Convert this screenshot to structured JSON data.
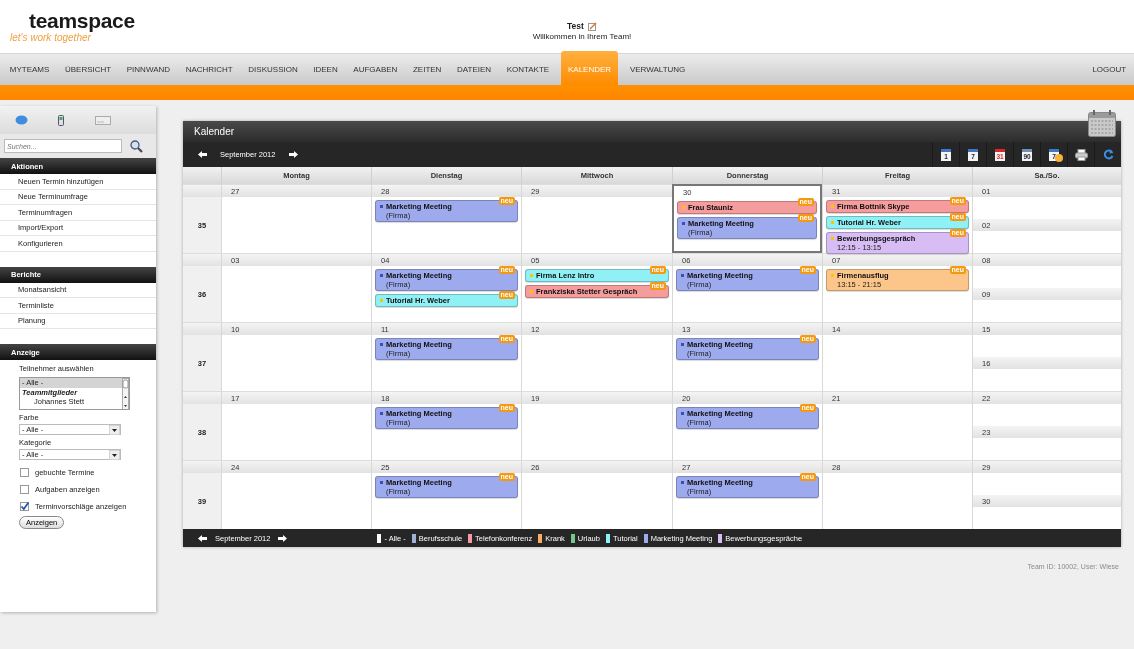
{
  "header": {
    "logo": "teamspace",
    "tagline": "let's work together",
    "user": "Test",
    "welcome": "Willkommen in Ihrem Team!"
  },
  "nav": {
    "tabs": [
      {
        "label": "MYTEAMS",
        "selected": false
      },
      {
        "label": "ÜBERSICHT",
        "selected": false
      },
      {
        "label": "PINNWAND",
        "selected": false
      },
      {
        "label": "NACHRICHT",
        "selected": false
      },
      {
        "label": "DISKUSSION",
        "selected": false
      },
      {
        "label": "IDEEN",
        "selected": false
      },
      {
        "label": "AUFGABEN",
        "selected": false
      },
      {
        "label": "ZEITEN",
        "selected": false
      },
      {
        "label": "DATEIEN",
        "selected": false
      },
      {
        "label": "KONTAKTE",
        "selected": false
      },
      {
        "label": "KALENDER",
        "selected": true
      },
      {
        "label": "VERWALTUNG",
        "selected": false
      }
    ],
    "logout": "LOGOUT"
  },
  "sidebar": {
    "search": {
      "placeholder": "Suchen..."
    },
    "sections": [
      {
        "title": "Aktionen",
        "items": [
          "Neuen Termin hinzufügen",
          "Neue Terminumfrage",
          "Terminumfragen",
          "Import/Export",
          "Konfigurieren"
        ]
      },
      {
        "title": "Berichte",
        "items": [
          "Monatsansicht",
          "Terminliste",
          "Planung"
        ]
      }
    ],
    "display": {
      "title": "Anzeige",
      "participants_label": "Teilnehmer auswählen",
      "participants": [
        {
          "label": "- Alle -",
          "kind": "option",
          "selected": true
        },
        {
          "label": "Teammitglieder",
          "kind": "group",
          "selected": false
        },
        {
          "label": "Johannes Stett",
          "kind": "member",
          "selected": false
        }
      ],
      "color_label": "Farbe",
      "color_value": "- Alle -",
      "category_label": "Kategorie",
      "category_value": "- Alle -",
      "checkboxes": [
        {
          "label": "gebuchte Termine",
          "checked": false
        },
        {
          "label": "Aufgaben anzeigen",
          "checked": false
        },
        {
          "label": "Terminvorschläge anzeigen",
          "checked": true
        }
      ],
      "button": "Anzeigen"
    }
  },
  "calendar": {
    "title": "Kalender",
    "month": "September 2012",
    "toolbar": [
      {
        "kind": "page",
        "label": "1",
        "color": "#3d78c4"
      },
      {
        "kind": "page",
        "label": "7",
        "color": "#3d78c4"
      },
      {
        "kind": "page",
        "label": "31",
        "color": "#d9262b"
      },
      {
        "kind": "page",
        "label": "90",
        "color": "#6f8fb5"
      },
      {
        "kind": "person",
        "label": "7",
        "color": "#3d78c4"
      },
      {
        "kind": "print"
      },
      {
        "kind": "refresh"
      }
    ],
    "columns": [
      "Montag",
      "Dienstag",
      "Mittwoch",
      "Donnerstag",
      "Freitag",
      "Sa./So."
    ],
    "weeks": [
      {
        "number": "35",
        "days": [
          {
            "date": "27"
          },
          {
            "date": "28",
            "events": [
              {
                "kind": "team",
                "title": "Marketing Meeting",
                "detail": "(Firma)",
                "color": "#9eaaee",
                "badge": "neu"
              }
            ]
          },
          {
            "date": "29"
          },
          {
            "date": "30",
            "today": true,
            "events": [
              {
                "kind": "personal",
                "title": "Frau Stauniz",
                "color": "#f59c9c",
                "badge": "neu"
              },
              {
                "kind": "team",
                "title": "Marketing Meeting",
                "detail": "(Firma)",
                "color": "#9eaaee",
                "badge": "neu"
              }
            ]
          },
          {
            "date": "31",
            "events": [
              {
                "kind": "personal",
                "title": "Firma Bottnik Skype",
                "color": "#f59c9c",
                "badge": "neu"
              },
              {
                "kind": "personal",
                "title": "Tutorial Hr. Weber",
                "color": "#8ff0f5",
                "badge": "neu"
              },
              {
                "kind": "personal",
                "title": "Bewerbungsgespräch",
                "detail": "12:15 - 13:15",
                "color": "#d8bdf5",
                "badge": "neu"
              }
            ]
          }
        ],
        "weekend": [
          {
            "date": "01"
          },
          {
            "date": "02"
          }
        ]
      },
      {
        "number": "36",
        "days": [
          {
            "date": "03"
          },
          {
            "date": "04",
            "events": [
              {
                "kind": "team",
                "title": "Marketing Meeting",
                "detail": "(Firma)",
                "color": "#9eaaee",
                "badge": "neu"
              },
              {
                "kind": "personal",
                "title": "Tutorial Hr. Weber",
                "color": "#8ff0f5",
                "badge": "neu"
              }
            ]
          },
          {
            "date": "05",
            "events": [
              {
                "kind": "personal",
                "title": "Firma Lenz Intro",
                "color": "#8ff0f5",
                "badge": "neu"
              },
              {
                "kind": "personal",
                "title": "Frankziska Stetter Gespräch",
                "color": "#f59c9c",
                "badge": "neu"
              }
            ]
          },
          {
            "date": "06",
            "events": [
              {
                "kind": "team",
                "title": "Marketing Meeting",
                "detail": "(Firma)",
                "color": "#9eaaee",
                "badge": "neu"
              }
            ]
          },
          {
            "date": "07",
            "events": [
              {
                "kind": "personal",
                "title": "Firmenausflug",
                "detail": "13:15 - 21:15",
                "color": "#fcc68a",
                "badge": "neu"
              }
            ]
          }
        ],
        "weekend": [
          {
            "date": "08"
          },
          {
            "date": "09"
          }
        ]
      },
      {
        "number": "37",
        "days": [
          {
            "date": "10"
          },
          {
            "date": "11",
            "events": [
              {
                "kind": "team",
                "title": "Marketing Meeting",
                "detail": "(Firma)",
                "color": "#9eaaee",
                "badge": "neu"
              }
            ]
          },
          {
            "date": "12"
          },
          {
            "date": "13",
            "events": [
              {
                "kind": "team",
                "title": "Marketing Meeting",
                "detail": "(Firma)",
                "color": "#9eaaee",
                "badge": "neu"
              }
            ]
          },
          {
            "date": "14"
          }
        ],
        "weekend": [
          {
            "date": "15"
          },
          {
            "date": "16"
          }
        ]
      },
      {
        "number": "38",
        "days": [
          {
            "date": "17"
          },
          {
            "date": "18",
            "events": [
              {
                "kind": "team",
                "title": "Marketing Meeting",
                "detail": "(Firma)",
                "color": "#9eaaee",
                "badge": "neu"
              }
            ]
          },
          {
            "date": "19"
          },
          {
            "date": "20",
            "events": [
              {
                "kind": "team",
                "title": "Marketing Meeting",
                "detail": "(Firma)",
                "color": "#9eaaee",
                "badge": "neu"
              }
            ]
          },
          {
            "date": "21"
          }
        ],
        "weekend": [
          {
            "date": "22"
          },
          {
            "date": "23"
          }
        ]
      },
      {
        "number": "39",
        "days": [
          {
            "date": "24"
          },
          {
            "date": "25",
            "events": [
              {
                "kind": "team",
                "title": "Marketing Meeting",
                "detail": "(Firma)",
                "color": "#9eaaee",
                "badge": "neu"
              }
            ]
          },
          {
            "date": "26"
          },
          {
            "date": "27",
            "events": [
              {
                "kind": "team",
                "title": "Marketing Meeting",
                "detail": "(Firma)",
                "color": "#9eaaee",
                "badge": "neu"
              }
            ]
          },
          {
            "date": "28"
          }
        ],
        "weekend": [
          {
            "date": "29"
          },
          {
            "date": "30"
          }
        ]
      }
    ],
    "footer_month": "September 2012",
    "legend": [
      {
        "label": "- Alle -",
        "color": "#ffffff"
      },
      {
        "label": "Berufsschule",
        "color": "#9fb1d6"
      },
      {
        "label": "Telefonkonferenz",
        "color": "#f39aa6"
      },
      {
        "label": "Krank",
        "color": "#fbab63"
      },
      {
        "label": "Urlaub",
        "color": "#74c98a"
      },
      {
        "label": "Tutorial",
        "color": "#8ff0f5"
      },
      {
        "label": "Marketing Meeting",
        "color": "#9eaaee"
      },
      {
        "label": "Bewerbungsgespräche",
        "color": "#d8bdf5"
      }
    ]
  },
  "status": "Team ID: 10002, User: Wiese"
}
